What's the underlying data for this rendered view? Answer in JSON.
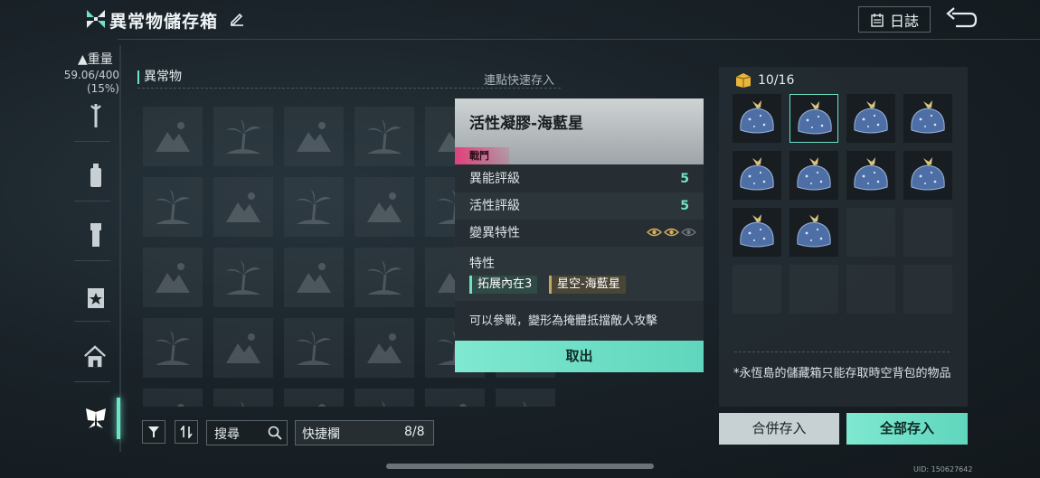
{
  "header": {
    "title": "異常物儲存箱",
    "log_label": "日誌"
  },
  "sidebar": {
    "weight_label": "重量",
    "weight_value": "59.06/400",
    "weight_percent": "(15%)",
    "items": [
      "wrench-icon",
      "bottle-icon",
      "flashlight-icon",
      "star-badge-icon",
      "home-icon",
      "butterfly-icon"
    ]
  },
  "inventory": {
    "label": "異常物",
    "quick_store_hint": "連點快速存入",
    "search_placeholder": "搜尋",
    "quickbar_label": "快捷欄",
    "quickbar_count": "8/8"
  },
  "detail": {
    "name": "活性凝膠-海藍星",
    "tag": "戰鬥",
    "rows": [
      {
        "label": "異能評級",
        "value": "5"
      },
      {
        "label": "活性評級",
        "value": "5"
      }
    ],
    "mutation_label": "變異特性",
    "mutation_level": 2,
    "mutation_max": 3,
    "traits_label": "特性",
    "traits": [
      "拓展內在3",
      "星空-海藍星"
    ],
    "description": "可以參戰，變形為掩體抵擋敵人攻擊",
    "take_label": "取出"
  },
  "storage": {
    "capacity": "10/16",
    "note": "*永恆島的儲藏箱只能存取時空背包的物品",
    "merge_label": "合併存入",
    "store_all_label": "全部存入"
  },
  "uid": "UID: 150627642",
  "colors": {
    "accent": "#6de3c8",
    "tag": "#e0417a"
  }
}
